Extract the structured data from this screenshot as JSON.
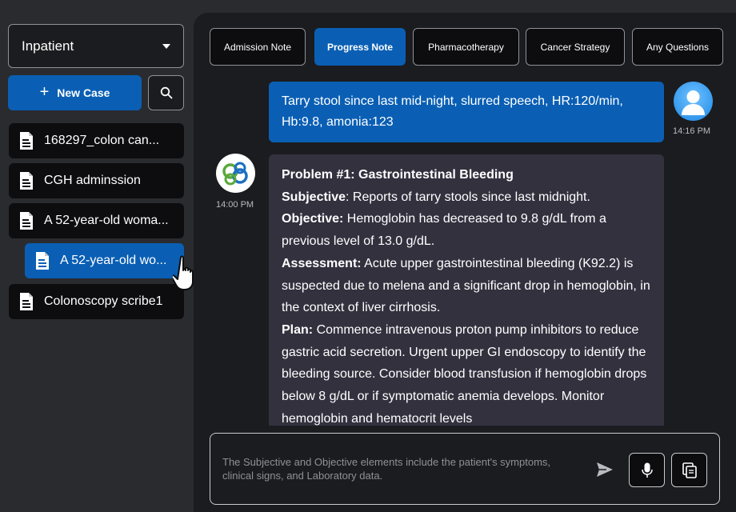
{
  "sidebar": {
    "mode_select": {
      "value": "Inpatient"
    },
    "new_case_label": "New Case",
    "cases": [
      {
        "label": "168297_colon can..."
      },
      {
        "label": "CGH adminssion"
      },
      {
        "label": "A 52-year-old woma..."
      },
      {
        "label": "A 52-year-old wo..."
      },
      {
        "label": "Colonoscopy scribe1"
      }
    ]
  },
  "tabs": [
    {
      "label": "Admission Note"
    },
    {
      "label": "Progress Note"
    },
    {
      "label": "Pharmacotherapy"
    },
    {
      "label": "Cancer Strategy"
    },
    {
      "label": "Any Questions"
    }
  ],
  "chat": {
    "user_message": "Tarry stool since last mid-night, slurred speech, HR:120/min, Hb:9.8, amonia:123",
    "user_time": "14:16 PM",
    "bot_time": "14:00 PM",
    "bot_message": [
      {
        "heading": "Problem #1: Gastrointestinal Bleeding",
        "text": ""
      },
      {
        "heading": "Subjective",
        "text": ": Reports of tarry stools since last midnight."
      },
      {
        "heading": "Objective:",
        "text": " Hemoglobin has decreased to 9.8 g/dL from a previous level of 13.0 g/dL."
      },
      {
        "heading": "Assessment:",
        "text": " Acute upper gastrointestinal bleeding (K92.2) is suspected due to melena and a significant drop in hemoglobin, in the context of liver cirrhosis."
      },
      {
        "heading": "Plan:",
        "text": " Commence intravenous proton pump inhibitors to reduce gastric acid secretion. Urgent upper GI endoscopy to identify the bleeding source. Consider blood transfusion if hemoglobin drops below 8 g/dL or if symptomatic anemia develops. Monitor hemoglobin and hematocrit levels"
      }
    ]
  },
  "input": {
    "placeholder": "The Subjective and Objective elements include the patient's symptoms, clinical signs, and Laboratory data."
  },
  "icons": {
    "doc": "document-icon",
    "doc_edit": "document-edit-icon",
    "search": "search-icon",
    "send": "send-icon",
    "mic": "microphone-icon",
    "copy": "copy-icon"
  },
  "colors": {
    "accent": "#0a5fb4",
    "bot_bubble": "#34313f",
    "panel": "#1b1c1f",
    "background": "#2a2b2f"
  }
}
